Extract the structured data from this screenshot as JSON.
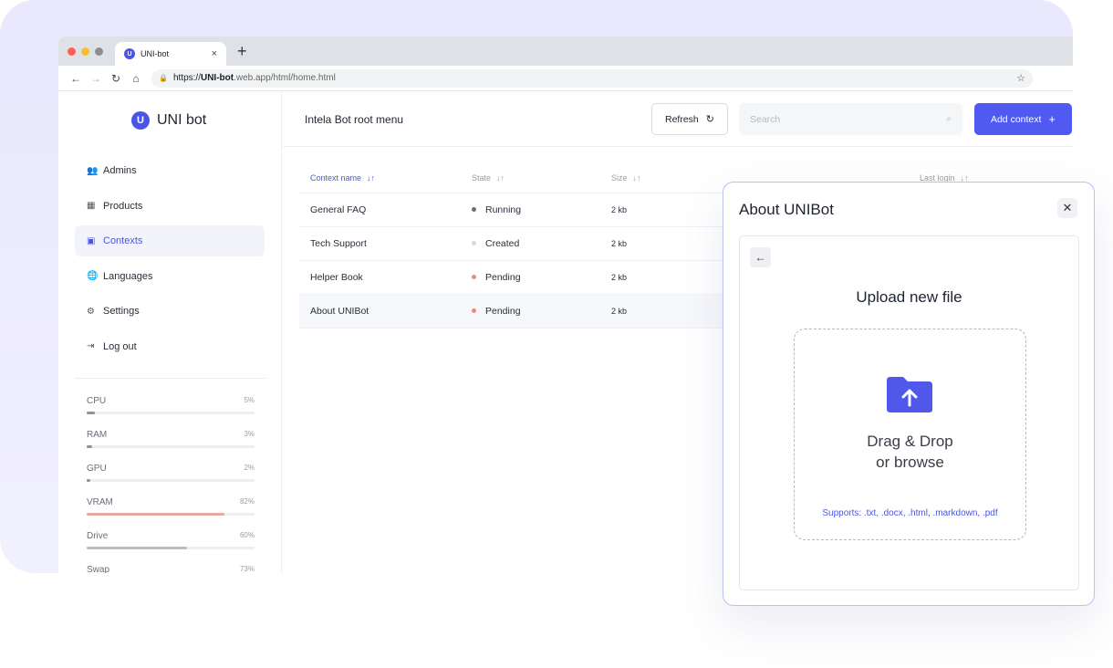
{
  "browser": {
    "tab_title": "UNI-bot",
    "tab_close": "×",
    "new_tab": "+",
    "url_prefix": "https://",
    "url_domain": "UNI-bot",
    "url_rest": ".web.app/html/home.html"
  },
  "brand": {
    "name": "UNI bot",
    "logo_letter": "U"
  },
  "sidebar": {
    "items": [
      {
        "label": "Admins",
        "icon": "users-icon",
        "glyph": "👥",
        "active": false
      },
      {
        "label": "Products",
        "icon": "box-icon",
        "glyph": "▦",
        "active": false
      },
      {
        "label": "Contexts",
        "icon": "context-icon",
        "glyph": "▣",
        "active": true
      },
      {
        "label": "Languages",
        "icon": "globe-icon",
        "glyph": "🌐",
        "active": false
      },
      {
        "label": "Settings",
        "icon": "gear-icon",
        "glyph": "⚙",
        "active": false
      },
      {
        "label": "Log out",
        "icon": "logout-icon",
        "glyph": "⇥",
        "active": false
      }
    ],
    "metrics": [
      {
        "label": "CPU",
        "pct": "5%",
        "value": 0.05,
        "color": "#8e909a"
      },
      {
        "label": "RAM",
        "pct": "3%",
        "value": 0.03,
        "color": "#8e909a"
      },
      {
        "label": "GPU",
        "pct": "2%",
        "value": 0.02,
        "color": "#8e909a"
      },
      {
        "label": "VRAM",
        "pct": "82%",
        "value": 0.82,
        "color": "#e9a99c"
      },
      {
        "label": "Drive",
        "pct": "60%",
        "value": 0.6,
        "color": "#b9bcc4"
      },
      {
        "label": "Swap",
        "pct": "73%",
        "value": 0.73,
        "color": "#b9bcc4"
      }
    ]
  },
  "header": {
    "title": "Intela Bot root menu",
    "refresh_label": "Refresh",
    "search_placeholder": "Search",
    "add_label": "Add context",
    "add_glyph": "+"
  },
  "table": {
    "columns": [
      "Context name",
      "State",
      "Size",
      "Last login"
    ],
    "rows": [
      {
        "name": "General FAQ",
        "state": "Running",
        "state_color": "#6b6e78",
        "size": "2 kb"
      },
      {
        "name": "Tech Support",
        "state": "Created",
        "state_color": "#d6d8de",
        "size": "2 kb"
      },
      {
        "name": "Helper Book",
        "state": "Pending",
        "state_color": "#ef8a79",
        "size": "2 kb"
      },
      {
        "name": "About UNIBot",
        "state": "Pending",
        "state_color": "#ef8a79",
        "size": "2 kb"
      }
    ]
  },
  "modal": {
    "title": "About UNIBot",
    "upload_title": "Upload new file",
    "drop_line1": "Drag & Drop",
    "drop_line2": "or browse",
    "supports": "Supports: .txt, .docx, .html, .markdown, .pdf"
  },
  "colors": {
    "accent": "#5059f0",
    "running": "#6b6e78",
    "pending": "#ef8a79",
    "created": "#d6d8de"
  }
}
